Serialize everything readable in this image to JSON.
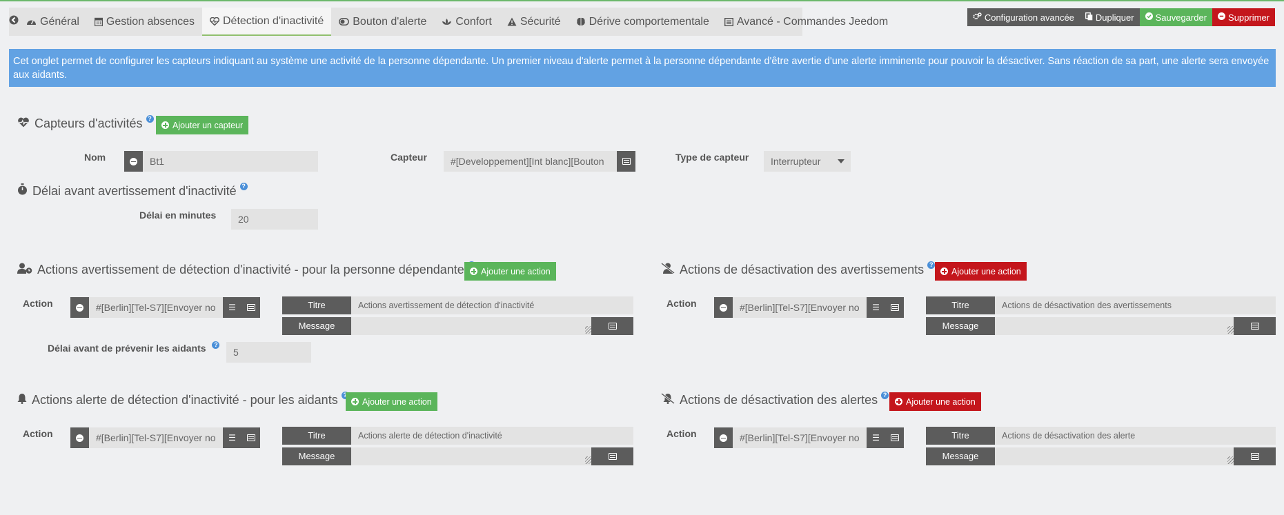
{
  "tabs": {
    "back_icon": "arrow-circle-left-icon",
    "items": [
      {
        "label": "Général",
        "icon": "dashboard-icon"
      },
      {
        "label": "Gestion absences",
        "icon": "calendar-icon"
      },
      {
        "label": "Détection d'inactivité",
        "icon": "heartbeat-icon",
        "active": true
      },
      {
        "label": "Bouton d'alerte",
        "icon": "toggle-icon"
      },
      {
        "label": "Confort",
        "icon": "lotus-icon"
      },
      {
        "label": "Sécurité",
        "icon": "warning-icon"
      },
      {
        "label": "Dérive comportementale",
        "icon": "brain-icon"
      },
      {
        "label": "Avancé - Commandes Jeedom",
        "icon": "list-alt-icon"
      }
    ]
  },
  "toolbar": {
    "config_label": "Configuration avancée",
    "duplicate_label": "Dupliquer",
    "save_label": "Sauvegarder",
    "delete_label": "Supprimer"
  },
  "info": {
    "text": "Cet onglet permet de configurer les capteurs indiquant au système une activité de la personne dépendante. Un premier niveau d'alerte permet à la personne dépendante d'être avertie d'une alerte imminente pour pouvoir la désactiver. Sans réaction de sa part, une alerte sera envoyée aux aidants."
  },
  "capteurs": {
    "title": "Capteurs d'activités",
    "add_label": "Ajouter un capteur",
    "nom_label": "Nom",
    "nom_value": "Bt1",
    "capteur_label": "Capteur",
    "capteur_value": "#[Developpement][Int blanc][Bouton",
    "type_label": "Type de capteur",
    "type_value": "Interrupteur"
  },
  "delai": {
    "title": "Délai avant avertissement d'inactivité",
    "minutes_label": "Délai en minutes",
    "minutes_value": "20"
  },
  "avertissement": {
    "title": "Actions avertissement de détection d'inactivité - pour la personne dépendante",
    "add_label": "Ajouter une action",
    "action_label": "Action",
    "action_value": "#[Berlin][Tel-S7][Envoyer no",
    "titre_label": "Titre",
    "titre_value": "Actions avertissement de détection d'inactivité",
    "message_label": "Message",
    "delai_aidants_label": "Délai avant de prévenir les aidants",
    "delai_aidants_value": "5"
  },
  "desact_avert": {
    "title": "Actions de désactivation des avertissements",
    "add_label": "Ajouter une action",
    "action_label": "Action",
    "action_value": "#[Berlin][Tel-S7][Envoyer no",
    "titre_label": "Titre",
    "titre_value": "Actions de désactivation des avertissements",
    "message_label": "Message"
  },
  "alerte": {
    "title": "Actions alerte de détection d'inactivité - pour les aidants",
    "add_label": "Ajouter une action",
    "action_label": "Action",
    "action_value": "#[Berlin][Tel-S7][Envoyer no",
    "titre_label": "Titre",
    "titre_value": "Actions alerte de détection d'inactivité",
    "message_label": "Message"
  },
  "desact_alerte": {
    "title": "Actions de désactivation des alertes",
    "add_label": "Ajouter une action",
    "action_label": "Action",
    "action_value": "#[Berlin][Tel-S7][Envoyer no",
    "titre_label": "Titre",
    "titre_value": "Actions de désactivation des alerte",
    "message_label": "Message"
  },
  "colors": {
    "green": "#5bb55b",
    "red": "#c4161c",
    "dark": "#5c5c5c",
    "info": "#62a2e3"
  }
}
